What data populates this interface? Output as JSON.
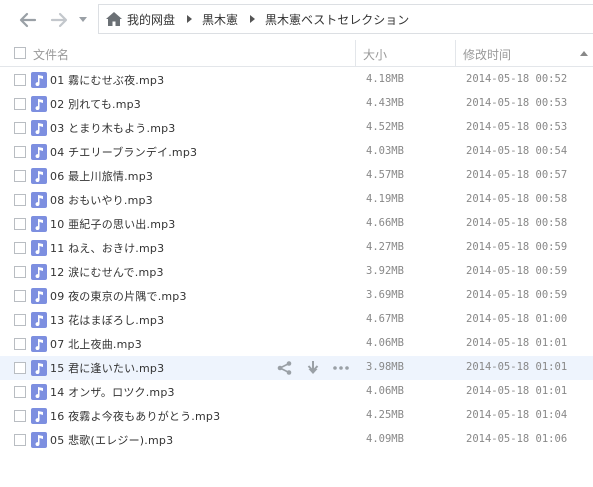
{
  "nav": {
    "breadcrumb": [
      "我的网盘",
      "黒木憲",
      "黒木憲ベストセレクション"
    ]
  },
  "header": {
    "name_label": "文件名",
    "size_label": "大小",
    "time_label": "修改时间",
    "sort": "ascending"
  },
  "files": [
    {
      "name": "01 霧にむせぶ夜.mp3",
      "size": "4.18MB",
      "time": "2014-05-18 00:52"
    },
    {
      "name": "02 別れても.mp3",
      "size": "4.43MB",
      "time": "2014-05-18 00:53"
    },
    {
      "name": "03 とまり木もよう.mp3",
      "size": "4.52MB",
      "time": "2014-05-18 00:53"
    },
    {
      "name": "04 チエリーブランデイ.mp3",
      "size": "4.03MB",
      "time": "2014-05-18 00:54"
    },
    {
      "name": "06 最上川旅情.mp3",
      "size": "4.57MB",
      "time": "2014-05-18 00:57"
    },
    {
      "name": "08 おもいやり.mp3",
      "size": "4.19MB",
      "time": "2014-05-18 00:58"
    },
    {
      "name": "10 亜紀子の思い出.mp3",
      "size": "4.66MB",
      "time": "2014-05-18 00:58"
    },
    {
      "name": "11 ねえ、おきけ.mp3",
      "size": "4.27MB",
      "time": "2014-05-18 00:59"
    },
    {
      "name": "12 涙にむせんで.mp3",
      "size": "3.92MB",
      "time": "2014-05-18 00:59"
    },
    {
      "name": "09 夜の東京の片隅で.mp3",
      "size": "3.69MB",
      "time": "2014-05-18 00:59"
    },
    {
      "name": "13 花はまぼろし.mp3",
      "size": "4.67MB",
      "time": "2014-05-18 01:00"
    },
    {
      "name": "07 北上夜曲.mp3",
      "size": "4.06MB",
      "time": "2014-05-18 01:01"
    },
    {
      "name": "15 君に逢いたい.mp3",
      "size": "3.98MB",
      "time": "2014-05-18 01:01"
    },
    {
      "name": "14 オンザ。ロツク.mp3",
      "size": "4.06MB",
      "time": "2014-05-18 01:01"
    },
    {
      "name": "16 夜霧よ今夜もありがとう.mp3",
      "size": "4.25MB",
      "time": "2014-05-18 01:04"
    },
    {
      "name": "05 悲歌(エレジー).mp3",
      "size": "4.09MB",
      "time": "2014-05-18 01:06"
    }
  ],
  "hover_row_index": 12,
  "row_actions": [
    "share-icon",
    "download-icon",
    "more-icon"
  ],
  "icons": {
    "back": "arrow-left-icon",
    "forward": "arrow-right-icon",
    "home": "home-icon",
    "file": "music-file-icon"
  },
  "colors": {
    "file_icon": "#7d8fe0",
    "hover_row": "#eef4fd",
    "text": "#333333",
    "meta_text": "#888888"
  }
}
